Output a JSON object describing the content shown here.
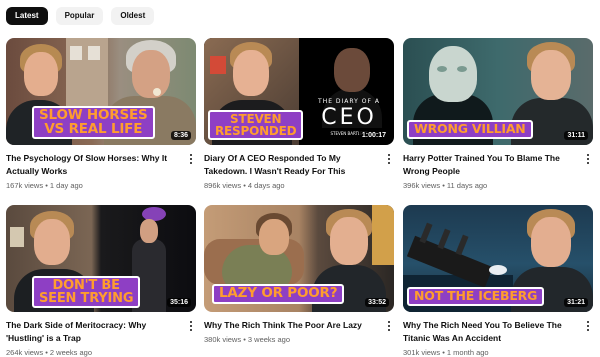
{
  "filters": [
    "Latest",
    "Popular",
    "Oldest"
  ],
  "active_filter": "Latest",
  "videos": [
    {
      "title": "The Psychology Of Slow Horses: Why It Actually Works",
      "views": "167k views",
      "age": "1 day ago",
      "duration": "8:36",
      "caption_lines": [
        "SLOW HORSES",
        "vs REAL LIFE"
      ]
    },
    {
      "title": "Diary Of A CEO Responded To My Takedown. I Wasn't Ready For This",
      "views": "896k views",
      "age": "4 days ago",
      "duration": "1:00:17",
      "caption_lines": [
        "STEVEN",
        "RESPONDED"
      ],
      "thumb_text": {
        "small": "THE DIARY OF A",
        "large": "CEO",
        "name": "STEVEN BARTLETT"
      }
    },
    {
      "title": "Harry Potter Trained You To Blame The Wrong People",
      "views": "396k views",
      "age": "11 days ago",
      "duration": "31:11",
      "caption_lines": [
        "WRONG VILLIAN"
      ]
    },
    {
      "title": "The Dark Side of Meritocracy: Why 'Hustling' is a Trap",
      "views": "264k views",
      "age": "2 weeks ago",
      "duration": "35:16",
      "caption_lines": [
        "DON'T BE",
        "SEEN TRYING"
      ]
    },
    {
      "title": "Why The Rich Think The Poor Are Lazy",
      "views": "380k views",
      "age": "3 weeks ago",
      "duration": "33:52",
      "caption_lines": [
        "LAZY OR POOR?"
      ]
    },
    {
      "title": "Why The Rich Need You To Believe The Titanic Was An Accident",
      "views": "301k views",
      "age": "1 month ago",
      "duration": "31:21",
      "caption_lines": [
        "NOT THE ICEBERG"
      ]
    }
  ]
}
